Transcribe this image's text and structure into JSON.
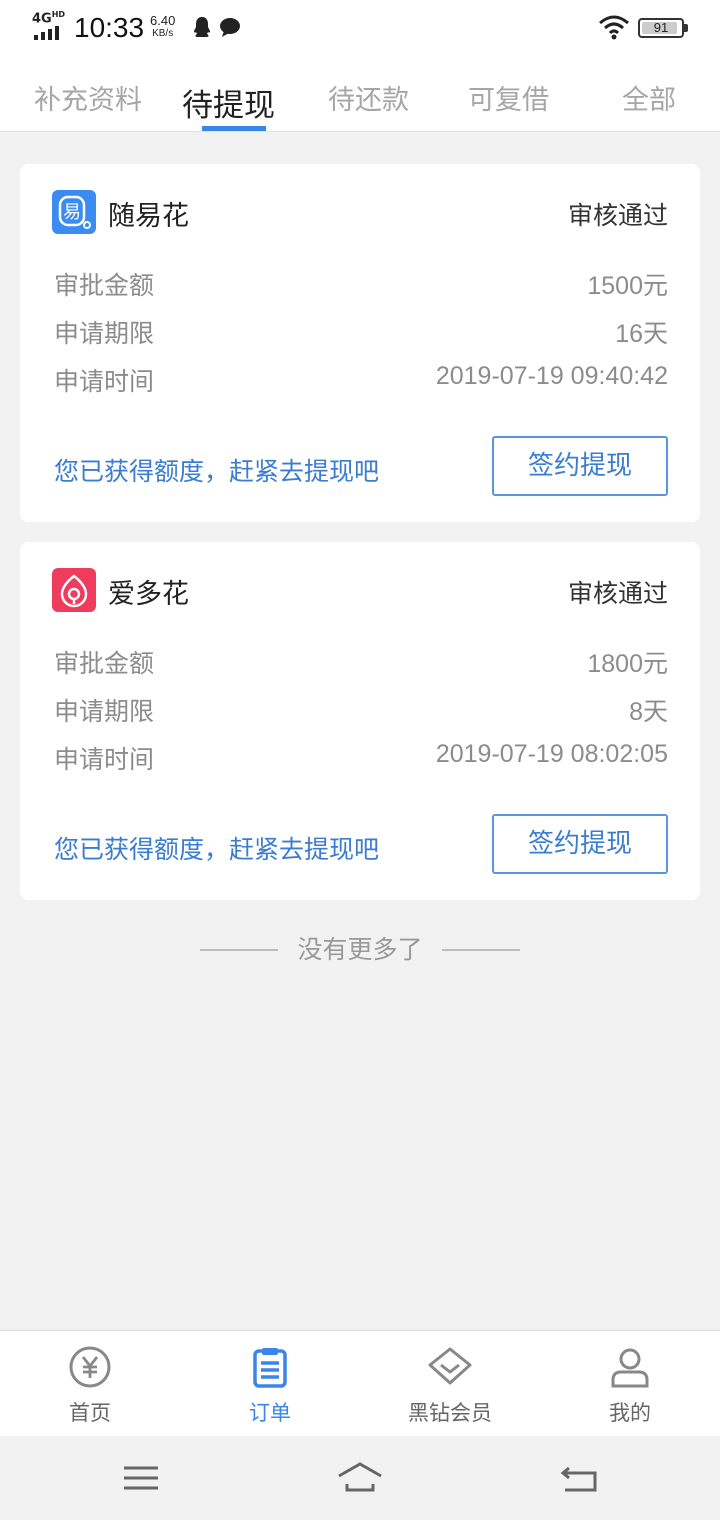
{
  "status_bar": {
    "network": "4G",
    "network_sup": "HD",
    "time": "10:33",
    "speed_value": "6.40",
    "speed_unit": "KB/s",
    "battery": "91",
    "battery_level": 0.91
  },
  "tabs": [
    {
      "label": "补充资料",
      "active": false
    },
    {
      "label": "待提现",
      "active": true
    },
    {
      "label": "待还款",
      "active": false
    },
    {
      "label": "可复借",
      "active": false
    },
    {
      "label": "全部",
      "active": false
    }
  ],
  "cards": [
    {
      "brand": "随易花",
      "logo_icon": "sui-yi-hua-logo",
      "status": "审核通过",
      "rows": [
        {
          "label": "审批金额",
          "value": "1500元"
        },
        {
          "label": "申请期限",
          "value": "16天"
        },
        {
          "label": "申请时间",
          "value": "2019-07-19 09:40:42"
        }
      ],
      "promo": "您已获得额度，赶紧去提现吧",
      "button": "签约提现"
    },
    {
      "brand": "爱多花",
      "logo_icon": "ai-duo-hua-logo",
      "status": "审核通过",
      "rows": [
        {
          "label": "审批金额",
          "value": "1800元"
        },
        {
          "label": "申请期限",
          "value": "8天"
        },
        {
          "label": "申请时间",
          "value": "2019-07-19 08:02:05"
        }
      ],
      "promo": "您已获得额度，赶紧去提现吧",
      "button": "签约提现"
    }
  ],
  "end_note": "没有更多了",
  "bottom_nav": [
    {
      "label": "首页",
      "icon": "yen-circle-icon",
      "active": false
    },
    {
      "label": "订单",
      "icon": "clipboard-icon",
      "active": true
    },
    {
      "label": "黑钻会员",
      "icon": "diamond-icon",
      "active": false
    },
    {
      "label": "我的",
      "icon": "person-icon",
      "active": false
    }
  ],
  "colors": {
    "accent": "#3a86e6",
    "link": "#3a7cd0",
    "logo_blue": "#3a8cf0",
    "logo_pink": "#ee3b5e"
  }
}
